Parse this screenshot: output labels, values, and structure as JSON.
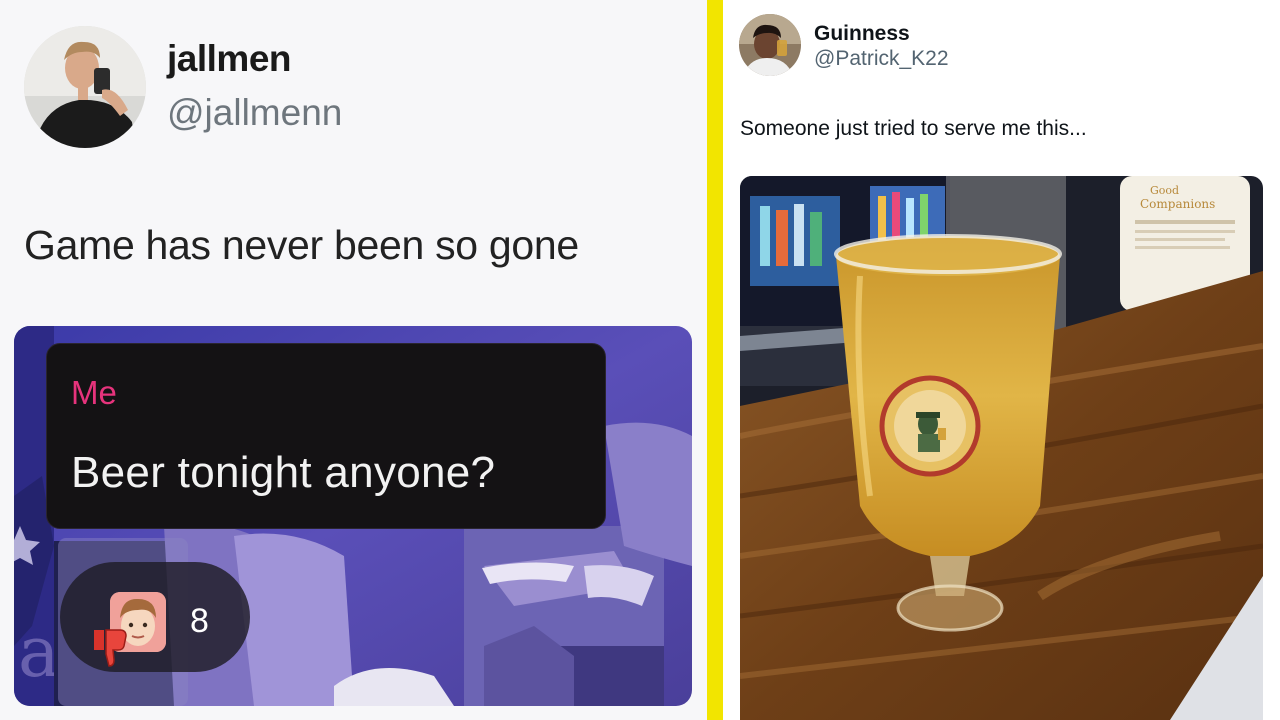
{
  "left_tweet": {
    "display_name": "jallmen",
    "handle": "@jallmenn",
    "text": "Game has never been so gone",
    "message": {
      "sender": "Me",
      "text": "Beer tonight anyone?"
    },
    "reaction": {
      "icon": "thumbs-down-icon",
      "count": "8"
    }
  },
  "right_tweet": {
    "display_name": "Guinness",
    "handle": "@Patrick_K22",
    "text": "Someone just tried to serve me this..."
  },
  "colors": {
    "divider": "#f2e500",
    "sender_name": "#e6337c",
    "handle_gray": "#6e767d"
  }
}
